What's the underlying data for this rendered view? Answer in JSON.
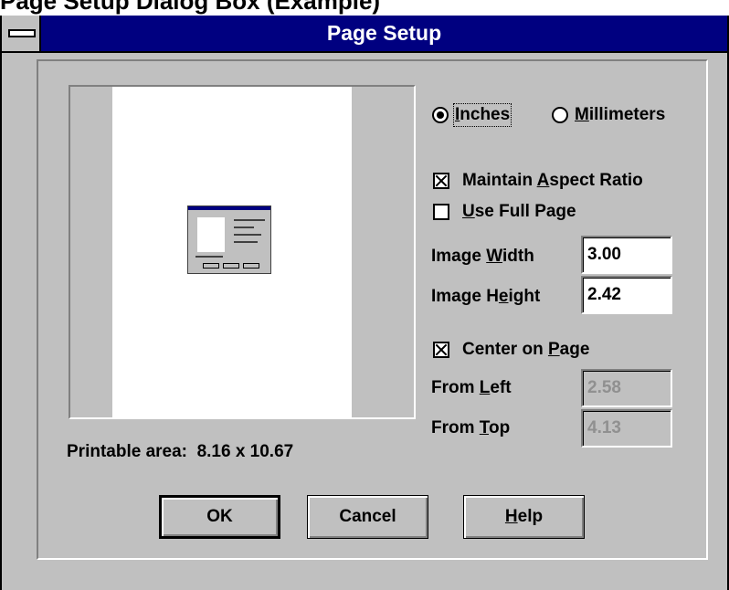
{
  "page_caption": "Page Setup Dialog Box (Example)",
  "window": {
    "title": "Page Setup"
  },
  "units": {
    "inches": {
      "pre": "",
      "acc": "I",
      "post": "nches",
      "selected": true
    },
    "millimeters": {
      "pre": "",
      "acc": "M",
      "post": "illimeters",
      "selected": false
    }
  },
  "options": {
    "maintain_aspect_ratio": {
      "pre": "Maintain ",
      "acc": "A",
      "post": "spect Ratio",
      "checked": true
    },
    "use_full_page": {
      "pre": "",
      "acc": "U",
      "post": "se Full Page",
      "checked": false
    },
    "center_on_page": {
      "pre": "Center on ",
      "acc": "P",
      "post": "age",
      "checked": true
    }
  },
  "fields": {
    "image_width": {
      "pre": "Image ",
      "acc": "W",
      "post": "idth",
      "value": "3.00"
    },
    "image_height": {
      "pre": "Image H",
      "acc": "e",
      "post": "ight",
      "value": "2.42"
    },
    "from_left": {
      "pre": "From ",
      "acc": "L",
      "post": "eft",
      "value": "2.58"
    },
    "from_top": {
      "pre": "From ",
      "acc": "T",
      "post": "op",
      "value": "4.13"
    }
  },
  "preview": {
    "printable_area_label": "Printable area:",
    "printable_area_value": "8.16 x 10.67"
  },
  "buttons": {
    "ok": {
      "pre": "OK",
      "acc": "",
      "post": ""
    },
    "cancel": {
      "pre": "Cancel",
      "acc": "",
      "post": ""
    },
    "help": {
      "pre": "",
      "acc": "H",
      "post": "elp"
    }
  },
  "colors": {
    "title_bar": "#000080",
    "dialog_face": "#c0c0c0",
    "disabled_text": "#909090"
  },
  "icons": {
    "system_menu": "system-menu-icon",
    "radio_selected": "radio-selected-icon",
    "checkbox_checked": "checkbox-checked-icon"
  }
}
